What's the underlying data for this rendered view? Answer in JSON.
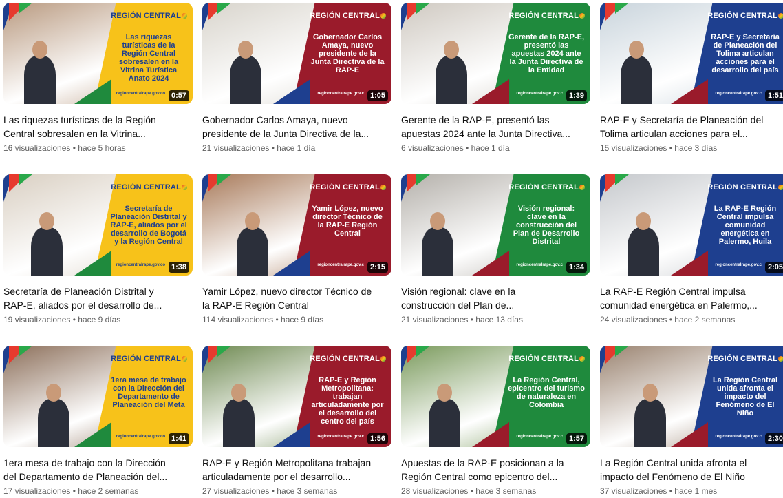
{
  "videos": [
    {
      "title_line1": "Las riquezas turísticas de la Región",
      "title_line2": "Central sobresalen en la Vitrina...",
      "views": "16 visualizaciones",
      "age": "hace 5 horas",
      "duration": "0:57",
      "headline": "Las riquezas turísticas de la Región Central sobresalen en la Vitrina Turística Anato 2024",
      "panel": "yellow",
      "photo": "#b99a80",
      "logo": "REGIÓN CENTRAL",
      "site": "regioncentralrape.gov.co"
    },
    {
      "title_line1": "Gobernador Carlos Amaya, nuevo",
      "title_line2": "presidente de la Junta Directiva de la...",
      "views": "21 visualizaciones",
      "age": "hace 1 día",
      "duration": "1:05",
      "headline": "Gobernador Carlos Amaya, nuevo presidente de la Junta Directiva de la RAP-E",
      "panel": "red",
      "photo": "#d8d4cc",
      "logo": "REGIÓN CENTRAL",
      "site": "regioncentralrape.gov.c"
    },
    {
      "title_line1": "Gerente de la RAP-E, presentó las",
      "title_line2": "apuestas 2024 ante la Junta Directiva...",
      "views": "6 visualizaciones",
      "age": "hace 1 día",
      "duration": "1:39",
      "headline": "Gerente de la RAP-E, presentó las apuestas 2024 ante la Junta Directiva de la Entidad",
      "panel": "green",
      "photo": "#cfc9c1",
      "logo": "REGIÓN CENTRAL",
      "site": "regioncentralrape.gov.c"
    },
    {
      "title_line1": "RAP-E y Secretaría de Planeación del",
      "title_line2": "Tolima articulan acciones para el...",
      "views": "15 visualizaciones",
      "age": "hace 3 días",
      "duration": "1:51",
      "headline": "RAP-E y Secretaría de Planeación del Tolima articulan acciones para el desarrollo del país",
      "panel": "blue",
      "photo": "#c9d4dc",
      "logo": "REGIÓN CENTRAL",
      "site": "regioncentralrape.gov.c"
    },
    {
      "title_line1": "Secretaría de Planeación Distrital y",
      "title_line2": "RAP-E, aliados por el desarrollo de...",
      "views": "19 visualizaciones",
      "age": "hace 9 días",
      "duration": "1:38",
      "headline": "Secretaría de Planeación Distrital y RAP-E, aliados por el desarrollo de Bogotá y la Región Central",
      "panel": "yellow",
      "photo": "#d9cfc2",
      "logo": "REGIÓN CENTRAL",
      "site": "regioncentralrape.gov.co"
    },
    {
      "title_line1": "Yamir López, nuevo director Técnico de",
      "title_line2": "la RAP-E Región Central",
      "views": "114 visualizaciones",
      "age": "hace 9 días",
      "duration": "2:15",
      "headline": "Yamir López, nuevo director Técnico de la RAP-E Región Central",
      "panel": "red",
      "photo": "#a87a5a",
      "logo": "REGIÓN CENTRAL",
      "site": "regioncentralrape.gov.c"
    },
    {
      "title_line1": "Visión regional: clave en la",
      "title_line2": "construcción del Plan de...",
      "views": "21 visualizaciones",
      "age": "hace 13 días",
      "duration": "1:34",
      "headline": "Visión regional: clave en la construcción del Plan de Desarrollo Distrital",
      "panel": "green",
      "photo": "#b4b0aa",
      "logo": "REGIÓN CENTRAL",
      "site": "regioncentralrape.gov.c"
    },
    {
      "title_line1": "La RAP-E Región Central impulsa",
      "title_line2": "comunidad energética en Palermo,...",
      "views": "24 visualizaciones",
      "age": "hace 2 semanas",
      "duration": "2:05",
      "headline": "La RAP-E Región Central impulsa comunidad energética en Palermo, Huila",
      "panel": "blue",
      "photo": "#c5c8cc",
      "logo": "REGIÓN CENTRAL",
      "site": "regioncentralrape.gov.c"
    },
    {
      "title_line1": "1era mesa de trabajo con la Dirección",
      "title_line2": "del Departamento de Planeación del...",
      "views": "17 visualizaciones",
      "age": "hace 2 semanas",
      "duration": "1:41",
      "headline": "1era mesa de trabajo con la Dirección del Departamento de Planeación del Meta",
      "panel": "yellow",
      "photo": "#8c6f5a",
      "logo": "REGIÓN CENTRAL",
      "site": "regioncentralrape.gov.co"
    },
    {
      "title_line1": "RAP-E y Región Metropolitana trabajan",
      "title_line2": "articuladamente por el desarrollo...",
      "views": "27 visualizaciones",
      "age": "hace 3 semanas",
      "duration": "1:56",
      "headline": "RAP-E y Región Metropolitana: trabajan articuladamente por el desarrollo del centro del país",
      "panel": "red",
      "photo": "#6f8a52",
      "logo": "REGIÓN CENTRAL",
      "site": "regioncentralrape.gov.c"
    },
    {
      "title_line1": "Apuestas de la RAP-E posicionan a la",
      "title_line2": "Región Central como epicentro del...",
      "views": "28 visualizaciones",
      "age": "hace 3 semanas",
      "duration": "1:57",
      "headline": "La Región Central, epicentro del turismo de naturaleza en Colombia",
      "panel": "green",
      "photo": "#7a9a5c",
      "logo": "REGIÓN CENTRAL",
      "site": "regioncentralrape.gov.c"
    },
    {
      "title_line1": "La Región Central unida afronta el",
      "title_line2": "impacto del Fenómeno de El Niño",
      "views": "37 visualizaciones",
      "age": "hace 1 mes",
      "duration": "2:30",
      "headline": "La Región Central unida afronta el impacto del Fenómeno de El Niño",
      "panel": "blue",
      "photo": "#9a8370",
      "logo": "REGIÓN CENTRAL",
      "site": "regioncentralrape.gov.c"
    }
  ],
  "separator": " • ",
  "colors": {
    "yellow": "#f7c21a",
    "green": "#1f8a3d",
    "red": "#9a1b2b",
    "blue": "#1e3f8f",
    "meta": "#606060"
  }
}
